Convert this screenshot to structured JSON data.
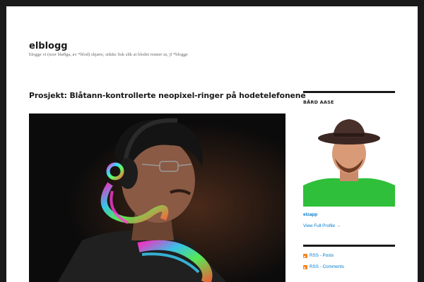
{
  "site": {
    "title": "elblogg",
    "tagline": "blogge vt (norr bløðga, av *blod) skjære, stikke fisk slik at blodet renner ut, jf *blogge"
  },
  "post": {
    "title": "Prosjekt: Blåtann-kontrollerte neopixel-ringer på hodetelefonene",
    "image_icon": "photo-person-headphones-neopixel"
  },
  "sidebar": {
    "widget_title": "BÅRD AASE",
    "avatar_icon": "profile-photo-man-hat",
    "profile_name": "elzapp",
    "view_profile": "View Full Profile →",
    "feeds": [
      {
        "icon": "rss-icon",
        "label": "RSS - Posts"
      },
      {
        "icon": "rss-icon",
        "label": "RSS - Comments"
      }
    ]
  },
  "colors": {
    "link": "#007acc",
    "text": "#1a1a1a",
    "frame": "#1a1a1a",
    "rss": "#f78422"
  }
}
